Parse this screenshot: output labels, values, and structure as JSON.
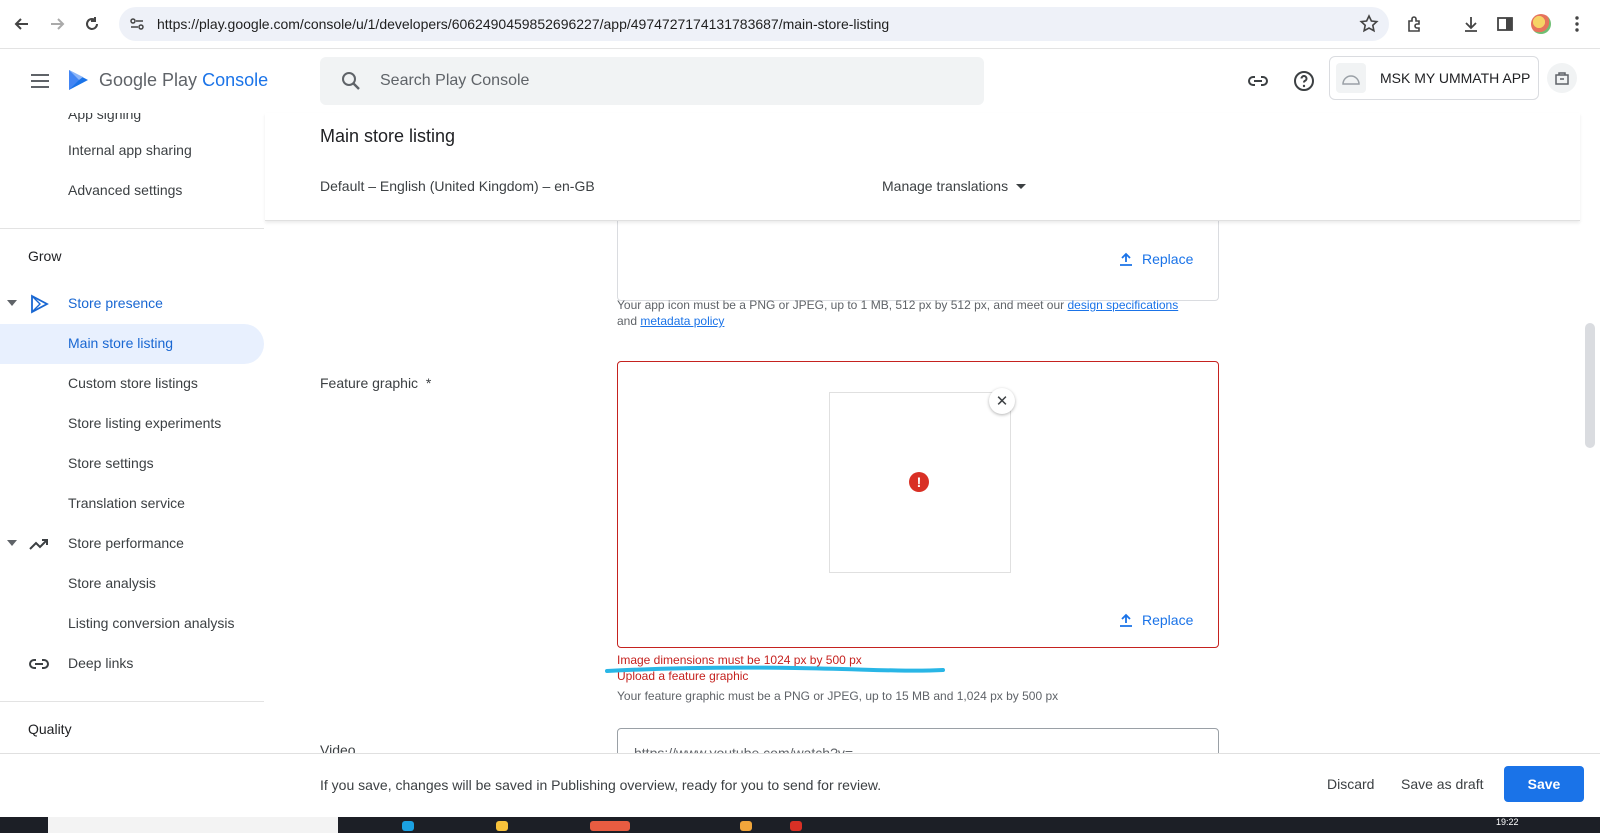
{
  "browser": {
    "url": "https://play.google.com/console/u/1/developers/6062490459852696227/app/4974727174131783687/main-store-listing"
  },
  "header": {
    "brand_prefix": "Google Play",
    "brand_suffix": "Console",
    "search_placeholder": "Search Play Console",
    "app_name": "MSK MY UMMATH APP"
  },
  "sidebar": {
    "items_top": [
      {
        "label": "App signing"
      },
      {
        "label": "Internal app sharing"
      },
      {
        "label": "Advanced settings"
      }
    ],
    "grow_section": "Grow",
    "store_presence": "Store presence",
    "presence_items": [
      {
        "label": "Main store listing",
        "active": true
      },
      {
        "label": "Custom store listings"
      },
      {
        "label": "Store listing experiments"
      },
      {
        "label": "Store settings"
      },
      {
        "label": "Translation service"
      }
    ],
    "store_performance": "Store performance",
    "performance_items": [
      {
        "label": "Store analysis"
      },
      {
        "label": "Listing conversion analysis"
      }
    ],
    "deep_links": "Deep links",
    "quality_section": "Quality"
  },
  "main": {
    "title": "Main store listing",
    "language": "Default – English (United Kingdom) – en-GB",
    "manage_translations": "Manage translations",
    "app_icon": {
      "replace": "Replace",
      "help_prefix": "Your app icon must be a PNG or JPEG, up to 1 MB, 512 px by 512 px, and meet our ",
      "help_link1": "design specifications",
      "help_mid": "and ",
      "help_link2": "metadata policy"
    },
    "feature_graphic": {
      "label": "Feature graphic",
      "required_mark": "*",
      "replace": "Replace",
      "error1": "Image dimensions must be 1024 px by 500 px",
      "error2": "Upload a feature graphic",
      "help": "Your feature graphic must be a PNG or JPEG, up to 15 MB and 1,024 px by 500 px"
    },
    "video": {
      "label": "Video",
      "value": "https://www.youtube.com/watch?v="
    }
  },
  "footer": {
    "message": "If you save, changes will be saved in Publishing overview, ready for you to send for review.",
    "discard": "Discard",
    "save_draft": "Save as draft",
    "save": "Save"
  },
  "taskbar": {
    "clock": "19:22"
  },
  "colors": {
    "accent": "#1a73e8",
    "error": "#c5221f",
    "active_bg": "#e8f0fe",
    "annotation": "#29b6e6"
  }
}
